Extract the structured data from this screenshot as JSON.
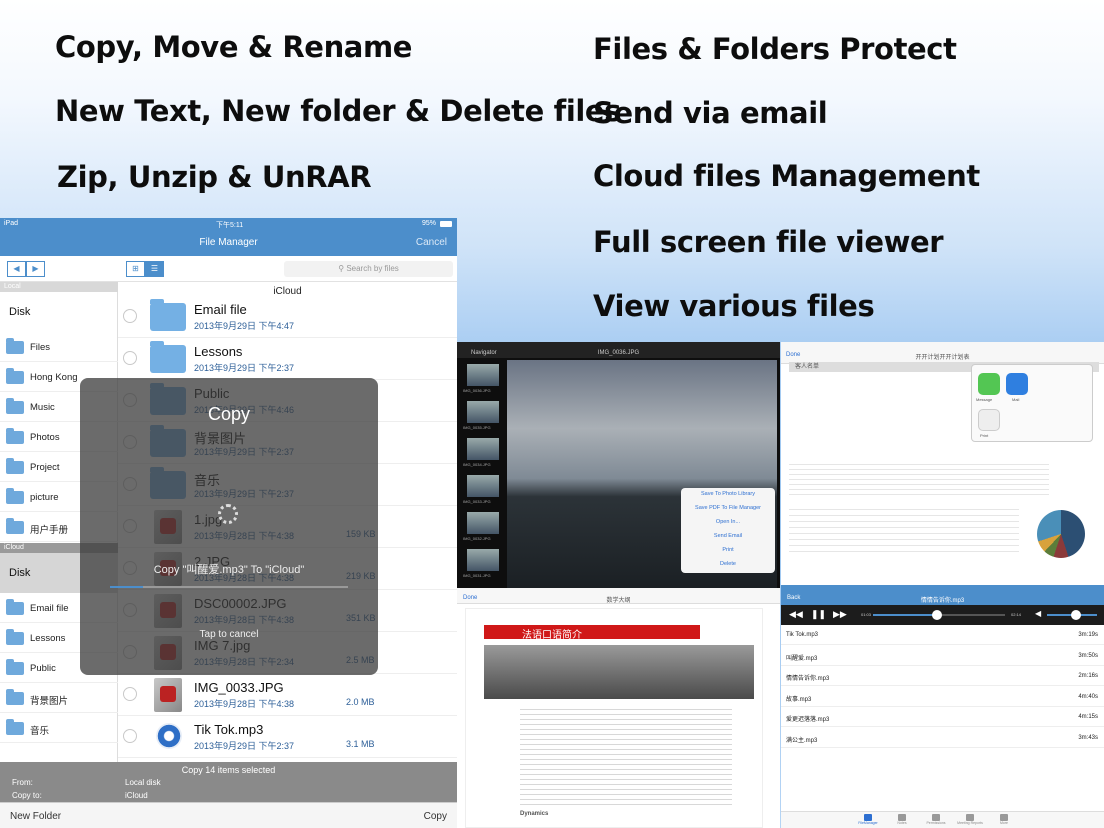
{
  "features": {
    "left": [
      "Copy, Move & Rename",
      "New Text, New folder & Delete files",
      "Zip, Unzip & UnRAR"
    ],
    "right": [
      "Files & Folders Protect",
      "Send via email",
      "Cloud files Management",
      "Full screen file viewer",
      "View various files"
    ]
  },
  "ipad": {
    "status": {
      "device": "iPad",
      "time": "下午5:11",
      "battery": "95%"
    },
    "nav": {
      "title": "File Manager",
      "cancel": "Cancel"
    },
    "search_placeholder": "Search by files",
    "sidebar": {
      "local_header": "Local",
      "local_disk": "Disk",
      "local_items": [
        "Files",
        "Hong Kong",
        "Music",
        "Photos",
        "Project",
        "picture",
        "用户手册"
      ],
      "icloud_header": "iCloud",
      "icloud_disk": "Disk",
      "icloud_items": [
        "Email file",
        "Lessons",
        "Public",
        "背景图片",
        "音乐"
      ]
    },
    "location": "iCloud",
    "files": [
      {
        "name": "Email file",
        "date": "2013年9月29日 下午4:47",
        "size": "",
        "kind": "folder"
      },
      {
        "name": "Lessons",
        "date": "2013年9月29日 下午2:37",
        "size": "",
        "kind": "folder"
      },
      {
        "name": "Public",
        "date": "2013年9月29日 下午4:46",
        "size": "",
        "kind": "folder"
      },
      {
        "name": "背景图片",
        "date": "2013年9月29日 下午2:37",
        "size": "",
        "kind": "folder"
      },
      {
        "name": "音乐",
        "date": "2013年9月29日 下午2:37",
        "size": "",
        "kind": "folder"
      },
      {
        "name": "1.jpg",
        "date": "2013年9月28日 下午4:38",
        "size": "159 KB",
        "kind": "image"
      },
      {
        "name": "2.JPG",
        "date": "2013年9月28日 下午4:38",
        "size": "219 KB",
        "kind": "image"
      },
      {
        "name": "DSC00002.JPG",
        "date": "2013年9月28日 下午4:38",
        "size": "351 KB",
        "kind": "image"
      },
      {
        "name": "IMG 7.jpg",
        "date": "2013年9月28日 下午2:34",
        "size": "2.5 MB",
        "kind": "image"
      },
      {
        "name": "IMG_0033.JPG",
        "date": "2013年9月28日 下午4:38",
        "size": "2.0 MB",
        "kind": "image"
      },
      {
        "name": "Tik Tok.mp3",
        "date": "2013年9月29日 下午2:37",
        "size": "3.1 MB",
        "kind": "music"
      }
    ],
    "hud": {
      "title": "Copy",
      "message": "Copy \"叫醒爱.mp3\" To \"iCloud\"",
      "cancel": "Tap to cancel",
      "progress": 0.14
    },
    "footer": {
      "summary": "Copy 14 items selected",
      "from_label": "From:",
      "from_value": "Local disk",
      "to_label": "Copy to:",
      "to_value": "iCloud"
    },
    "bottom": {
      "new_folder": "New Folder",
      "copy": "Copy"
    }
  },
  "photo": {
    "top_left": "Navigator",
    "title": "IMG_0036.JPG",
    "thumbs": [
      "IMG_0036.JPG",
      "IMG_0035.JPG",
      "IMG_0034.JPG",
      "IMG_0033.JPG",
      "IMG_0032.JPG",
      "IMG_0031.JPG"
    ],
    "menu": [
      "Save To Photo Library",
      "Save PDF To File Manager",
      "Open In...",
      "Send Email",
      "Print",
      "Delete"
    ]
  },
  "sheet": {
    "done": "Done",
    "title": "开开计划开开计划表",
    "tab": "客人名单",
    "share": [
      "Message",
      "Mail",
      "Print"
    ]
  },
  "doc": {
    "done": "Done",
    "title": "数学大纲",
    "heading": "法语口语简介",
    "subheading": "Dynamics"
  },
  "music": {
    "back": "Back",
    "title": "情情告诉你.mp3",
    "time_left": "01:03",
    "time_right": "02:14",
    "tracks": [
      {
        "name": "Tik Tok.mp3",
        "len": "3m:19s"
      },
      {
        "name": "叫醒爱.mp3",
        "len": "3m:50s"
      },
      {
        "name": "情情告诉你.mp3",
        "len": "2m:16s"
      },
      {
        "name": "故事.mp3",
        "len": "4m:40s"
      },
      {
        "name": "爱更迟落落.mp3",
        "len": "4m:15s"
      },
      {
        "name": "满公主.mp3",
        "len": "3m:43s"
      }
    ],
    "tabs": [
      "FileManager",
      "Notes",
      "Permissions",
      "Meeting Reports",
      "More"
    ]
  }
}
